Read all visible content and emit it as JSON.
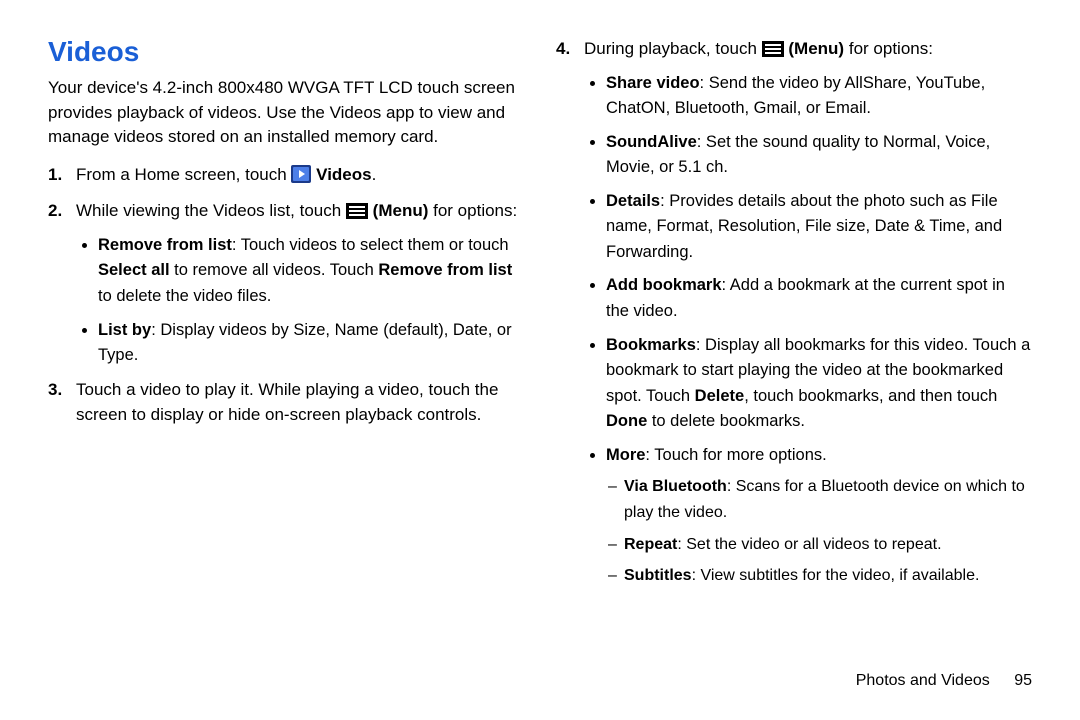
{
  "heading": "Videos",
  "intro": "Your device's 4.2-inch 800x480 WVGA TFT LCD touch screen provides playback of videos. Use the Videos app to view and manage videos stored on an installed memory card.",
  "steps": {
    "s1_pre": "From a Home screen, touch ",
    "s1_app": "Videos",
    "s1_post": ".",
    "s2_pre": "While viewing the Videos list, touch ",
    "s2_menu": "(Menu)",
    "s2_post": " for options:",
    "s3": "Touch a video to play it. While playing a video, touch the screen to display or hide on-screen playback controls.",
    "s4_pre": "During playback, touch ",
    "s4_menu": "(Menu)",
    "s4_post": " for options:"
  },
  "list_options": {
    "remove_label": "Remove from list",
    "remove_text_a": ": Touch videos to select them or touch ",
    "remove_select_all": "Select all",
    "remove_text_b": " to remove all videos. Touch ",
    "remove_from_list": "Remove from list",
    "remove_text_c": " to delete the video files.",
    "listby_label": "List by",
    "listby_text": ": Display videos by Size, Name (default), Date, or Type."
  },
  "playback_options": {
    "share_label": "Share video",
    "share_text": ": Send the video by AllShare, YouTube, ChatON, Bluetooth, Gmail, or Email.",
    "soundalive_label": "SoundAlive",
    "soundalive_text": ": Set the sound quality to Normal, Voice, Movie, or 5.1 ch.",
    "details_label": "Details",
    "details_text": ": Provides details about the photo such as File name, Format, Resolution, File size, Date & Time, and Forwarding.",
    "addbm_label": "Add bookmark",
    "addbm_text": ": Add a bookmark at the current spot in the video.",
    "bm_label": "Bookmarks",
    "bm_text_a": ": Display all bookmarks for this video. Touch a bookmark to start playing the video at the bookmarked spot. Touch ",
    "bm_delete": "Delete",
    "bm_text_b": ", touch bookmarks, and then touch ",
    "bm_done": "Done",
    "bm_text_c": " to delete bookmarks.",
    "more_label": "More",
    "more_text": ": Touch for more options.",
    "viabt_label": "Via Bluetooth",
    "viabt_text": ": Scans for a Bluetooth device on which to play the video.",
    "repeat_label": "Repeat",
    "repeat_text": ": Set the video or all videos to repeat.",
    "subs_label": "Subtitles",
    "subs_text": ": View subtitles for the video, if available."
  },
  "footer": {
    "section": "Photos and Videos",
    "page": "95"
  }
}
